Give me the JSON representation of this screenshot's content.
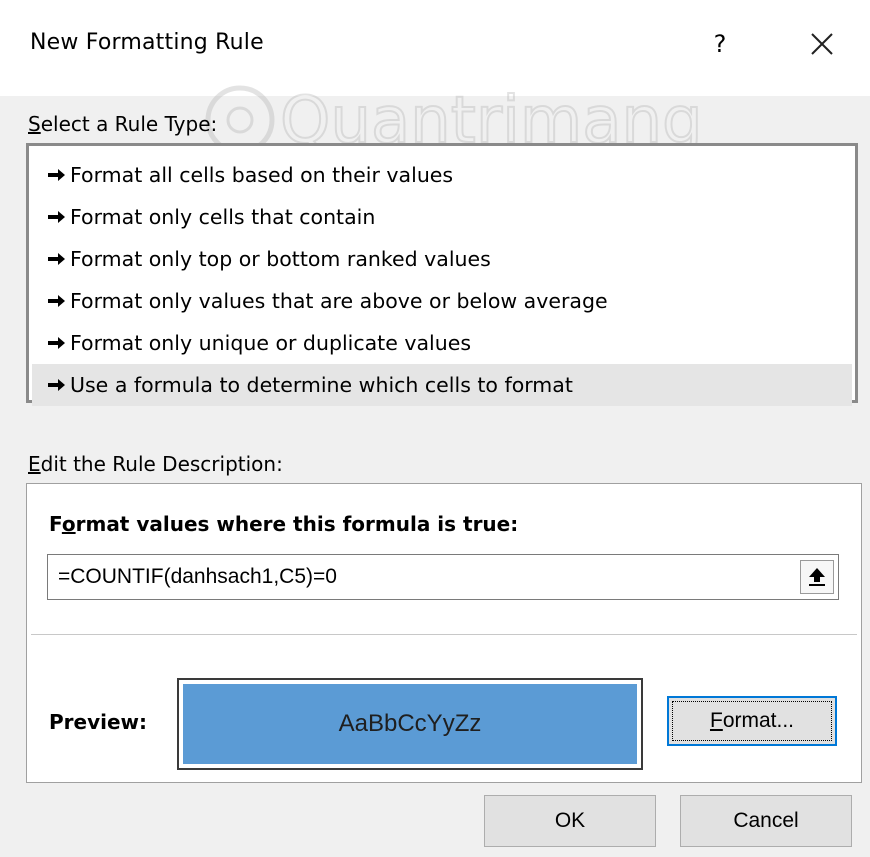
{
  "window": {
    "title": "New Formatting Rule",
    "help_label": "?",
    "close_icon": "close-icon"
  },
  "rule_type": {
    "heading_key": "S",
    "heading_rest": "elect a Rule Type:",
    "items": [
      {
        "label": "Format all cells based on their values"
      },
      {
        "label": "Format only cells that contain"
      },
      {
        "label": "Format only top or bottom ranked values"
      },
      {
        "label": "Format only values that are above or below average"
      },
      {
        "label": "Format only unique or duplicate values"
      },
      {
        "label": "Use a formula to determine which cells to format",
        "selected": true
      }
    ]
  },
  "description": {
    "heading_key": "E",
    "heading_rest": "dit the Rule Description:",
    "formula_label_key": "o",
    "formula_label_pre": "F",
    "formula_label_rest": "rmat values where this formula is true:",
    "formula_value": "=COUNTIF(danhsach1,C5)=0",
    "preview_label": "Preview:",
    "preview_text": "AaBbCcYyZz",
    "preview_fill_color": "#5b9bd5",
    "format_button_key": "F",
    "format_button_rest": "ormat..."
  },
  "buttons": {
    "ok": "OK",
    "cancel": "Cancel"
  },
  "watermark": {
    "text": "Quantrimang"
  }
}
